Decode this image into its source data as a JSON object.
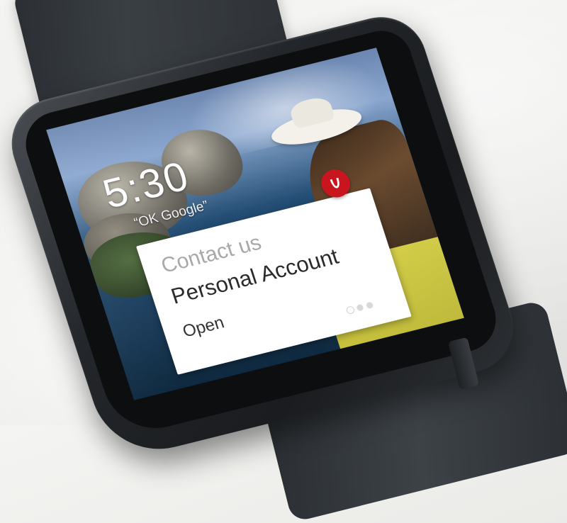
{
  "watch_face": {
    "time": "5:30",
    "hotword": "“OK Google”"
  },
  "notification_card": {
    "app_icon": "red-app-logo-icon",
    "label": "Contact us",
    "title": "Personal Account",
    "action": "Open",
    "pager": {
      "pages": 3,
      "active_index": 0
    }
  },
  "colors": {
    "app_icon_background": "#c9151e",
    "card_background": "#ffffff",
    "label_color": "#a8a8a8",
    "title_color": "#2a2a2a"
  }
}
